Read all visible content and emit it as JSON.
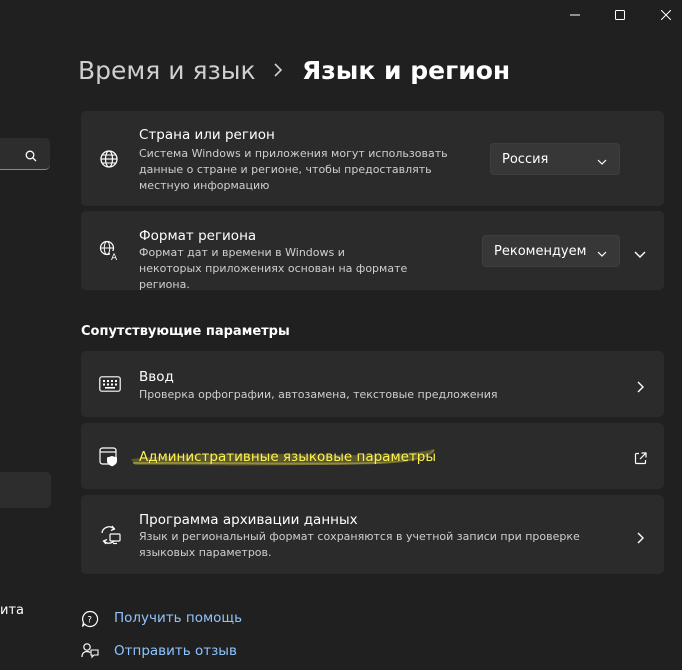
{
  "breadcrumb": {
    "parent": "Время и язык",
    "current": "Язык и регион"
  },
  "left_nav": {
    "partial_text": "ита"
  },
  "window_controls": [
    "minimize-icon",
    "maximize-icon",
    "close-icon"
  ],
  "country": {
    "title": "Страна или регион",
    "description": "Система Windows и приложения могут использовать данные о стране и регионе, чтобы предоставлять местную информацию",
    "value": "Россия"
  },
  "region_format": {
    "title": "Формат региона",
    "description": "Формат дат и времени в Windows и некоторых приложениях основан на формате региона.",
    "value": "Рекомендуем"
  },
  "related": {
    "heading": "Сопутствующие параметры",
    "items": [
      {
        "title": "Ввод",
        "description": "Проверка орфографии, автозамена, текстовые предложения",
        "icon": "keyboard-icon"
      },
      {
        "title": "Административные языковые параметры",
        "icon": "admin-shield-icon",
        "highlight": "#fff34d"
      },
      {
        "title": "Программа архивации данных",
        "description": "Язык и региональный формат сохраняются в учетной записи при проверке языковых параметров.",
        "icon": "backup-icon"
      }
    ]
  },
  "links": {
    "help": "Получить помощь",
    "feedback": "Отправить отзыв"
  },
  "colors": {
    "background": "#202020",
    "card": "#2b2b2b",
    "link": "#8fc4ff",
    "highlight": "#fff34d"
  }
}
